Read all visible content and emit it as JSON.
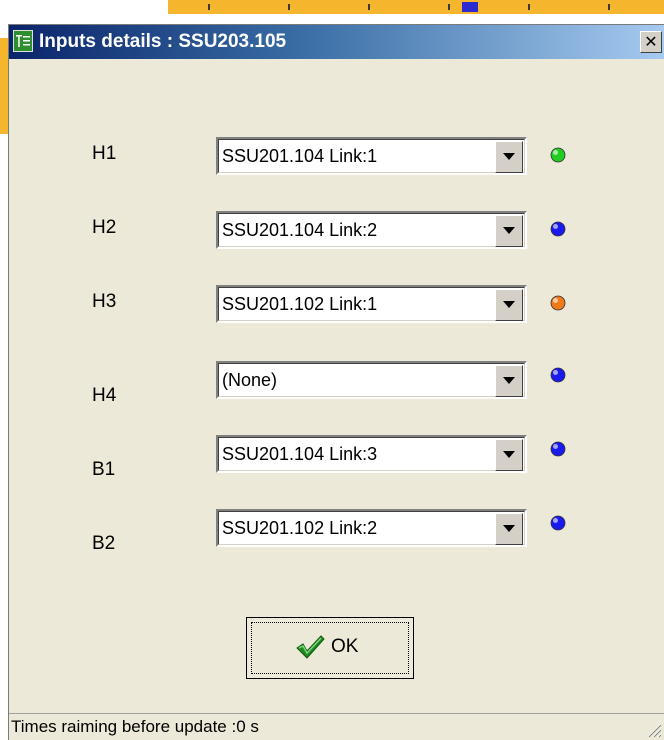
{
  "window": {
    "title": "Inputs details : SSU203.105",
    "close_glyph": "✕"
  },
  "inputs": [
    {
      "label": "H1",
      "value": "SSU201.104 Link:1",
      "status_color": "#22cc22"
    },
    {
      "label": "H2",
      "value": "SSU201.104 Link:2",
      "status_color": "#1a1aee"
    },
    {
      "label": "H3",
      "value": "SSU201.102 Link:1",
      "status_color": "#f07a1a"
    },
    {
      "label": "H4",
      "value": "(None)",
      "status_color": "#1a1aee"
    },
    {
      "label": "B1",
      "value": "SSU201.104 Link:3",
      "status_color": "#1a1aee"
    },
    {
      "label": "B2",
      "value": "SSU201.102 Link:2",
      "status_color": "#1a1aee"
    }
  ],
  "ok_button": {
    "label": "OK",
    "icon": "checkmark-icon"
  },
  "status_bar": {
    "text": "Times raiming before update :0 s"
  },
  "colors": {
    "title_gradient_start": "#0a246a",
    "title_gradient_end": "#a6caf0",
    "dialog_face": "#ece9d8"
  }
}
